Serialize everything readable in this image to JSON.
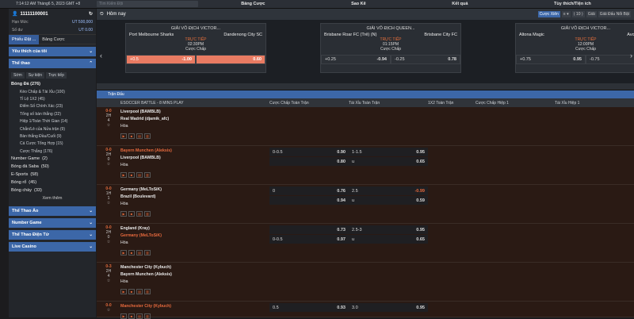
{
  "topbar": {
    "time": "7:14:12 AM Tháng6 5, 2023 GMT +8",
    "search_placeholder": "Tìm Kiếm Đội",
    "nav": [
      "Bảng Cược",
      "Sao Kê",
      "Kết quả",
      "Tùy thích/Tiện ích"
    ]
  },
  "account": {
    "id": "11111100001",
    "limit_label": "Hạn Mức",
    "limit_value": "UT 500,000",
    "balance_label": "Số dư",
    "balance_value": "UT 0.00"
  },
  "side_tabs": [
    "Phiếu Đặt ...",
    "Bảng Cược"
  ],
  "sections": {
    "favorites": "Yêu thích của tôi",
    "sports": "Thể thao"
  },
  "subtabs": [
    "Sớm",
    "Sự kiện",
    "Trực tiếp"
  ],
  "sports_list": [
    {
      "label": "Bóng Đá",
      "count": "(276)",
      "type": "grp"
    },
    {
      "label": "Kèo Chấp & Tài Xỉu",
      "count": "(100)",
      "type": "it"
    },
    {
      "label": "Tỉ Lệ 1X2",
      "count": "(45)",
      "type": "it"
    },
    {
      "label": "Điểm Số Chính Xác",
      "count": "(23)",
      "type": "it"
    },
    {
      "label": "Tổng số bàn thắng",
      "count": "(22)",
      "type": "it"
    },
    {
      "label": "Hiệp 1/Toàn Thời Gian",
      "count": "(14)",
      "type": "it"
    },
    {
      "label": "Chẵn/Lẻ của Nửa trận",
      "count": "(9)",
      "type": "it"
    },
    {
      "label": "Bàn thắng Đầu/Cuối",
      "count": "(9)",
      "type": "it"
    },
    {
      "label": "Cá Cược Tổng Hợp",
      "count": "(15)",
      "type": "it"
    },
    {
      "label": "Cược Thắng",
      "count": "(176)",
      "type": "it"
    },
    {
      "label": "Number Game",
      "count": "(2)",
      "type": "sport"
    },
    {
      "label": "Bóng đá Saba",
      "count": "(50)",
      "type": "sport"
    },
    {
      "label": "E-Sports",
      "count": "(58)",
      "type": "sport"
    },
    {
      "label": "Bóng rổ",
      "count": "(45)",
      "type": "sport"
    },
    {
      "label": "Bóng chày",
      "count": "(33)",
      "type": "sport"
    }
  ],
  "more": "Xem thêm",
  "bottom_sections": [
    "Thể Thao Ảo",
    "Number Game",
    "Thể Thao Điện Tử",
    "Live Casino"
  ],
  "header": {
    "title": "Hôm nay",
    "controls": [
      "Cược Xiên",
      "≡ ▾",
      "⟨ 10 ⟩",
      "Giải",
      "Giải Đấu Nổi Bật"
    ]
  },
  "carousel": [
    {
      "league": "GIẢI VÔ ĐỊCH VICTOR...",
      "home": "Port Melbourne Sharks",
      "away": "Dandenong City SC",
      "status": "TRỰC TIẾP",
      "time": "02:30PM",
      "market": "Cược Chấp",
      "o1": "+0.5",
      "o1v": "-1.00",
      "o2": "",
      "o2v": "0.60"
    },
    {
      "league": "GIẢI VÔ ĐỊCH QUEEN...",
      "home": "Brisbane Roar FC (Trẻ) (N)",
      "away": "Brisbane City FC",
      "status": "TRỰC TIẾP",
      "time": "01:15PM",
      "market": "Cược Chấp",
      "o1": "+0.25",
      "o1v": "-0.94",
      "o2": "-0.25",
      "o2v": "0.78"
    },
    {
      "league": "GIẢI VÔ ĐỊCH VICTOR...",
      "home": "Altona Magic",
      "away": "Avondale FC",
      "status": "TRỰC TIẾP",
      "time": "12:00PM",
      "market": "Cược Chấp",
      "o1": "+0.75",
      "o1v": "0.95",
      "o2": "-0.75",
      "o2v": ""
    }
  ],
  "section_label": "Trận Đấu",
  "thead": [
    "ESOCCER BATTLE - 8 MINS PLAY",
    "Cược Chấp Toàn Trận",
    "Tài Xỉu Toàn Trận",
    "1X2 Toàn Trận",
    "Cược Chấp Hiệp 1",
    "Tài Xỉu Hiệp 1"
  ],
  "matches": [
    {
      "score": "0-0",
      "half": "2H",
      "min": "4",
      "home": "Liverpool (BAMBLB)",
      "away": "Real Madrid (djamik_afc)",
      "draw": "Hòa",
      "home_red": false,
      "away_red": false,
      "hc": [],
      "ou": []
    },
    {
      "score": "0-0",
      "half": "2H",
      "min": "0",
      "home": "Bayern Munchen (Aleksis)",
      "away": "Liverpool (BAMBLB)",
      "draw": "Hòa",
      "home_red": true,
      "away_red": false,
      "hc": [
        [
          "0-0.5",
          "0.90"
        ],
        [
          "",
          "0.80"
        ]
      ],
      "ou": [
        [
          "1-1.5",
          "0.95"
        ],
        [
          "u",
          "0.65"
        ]
      ]
    },
    {
      "score": "0-0",
      "half": "1H",
      "min": "1",
      "home": "Germany (MeLToSiK)",
      "away": "Brazil (Boulevard)",
      "draw": "Hòa",
      "home_red": false,
      "away_red": false,
      "hc": [
        [
          "0",
          "0.76"
        ],
        [
          "",
          "0.94"
        ]
      ],
      "ou": [
        [
          "2.5",
          "-0.99"
        ],
        [
          "u",
          "0.59"
        ]
      ]
    },
    {
      "score": "0-0",
      "half": "2H",
      "min": "0",
      "home": "England (Kray)",
      "away": "Germany (MeLToSiK)",
      "draw": "Hòa",
      "home_red": false,
      "away_red": true,
      "hc": [
        [
          "",
          "0.73"
        ],
        [
          "0-0.5",
          "0.97"
        ]
      ],
      "ou": [
        [
          "2.5-3",
          "0.95"
        ],
        [
          "u",
          "0.65"
        ]
      ]
    },
    {
      "score": "0-3",
      "half": "2H",
      "min": "4",
      "home": "Manchester City (Kybuch)",
      "away": "Bayern Munchen (Aleksis)",
      "draw": "Hòa",
      "home_red": false,
      "away_red": false,
      "hc": [],
      "ou": []
    },
    {
      "score": "0-0",
      "half": "",
      "min": "",
      "home": "Manchester City (Kybuch)",
      "away": "",
      "draw": "",
      "home_red": true,
      "away_red": false,
      "hc": [
        [
          "0.5",
          "0.93"
        ]
      ],
      "ou": [
        [
          "3.0",
          "0.95"
        ]
      ]
    }
  ]
}
